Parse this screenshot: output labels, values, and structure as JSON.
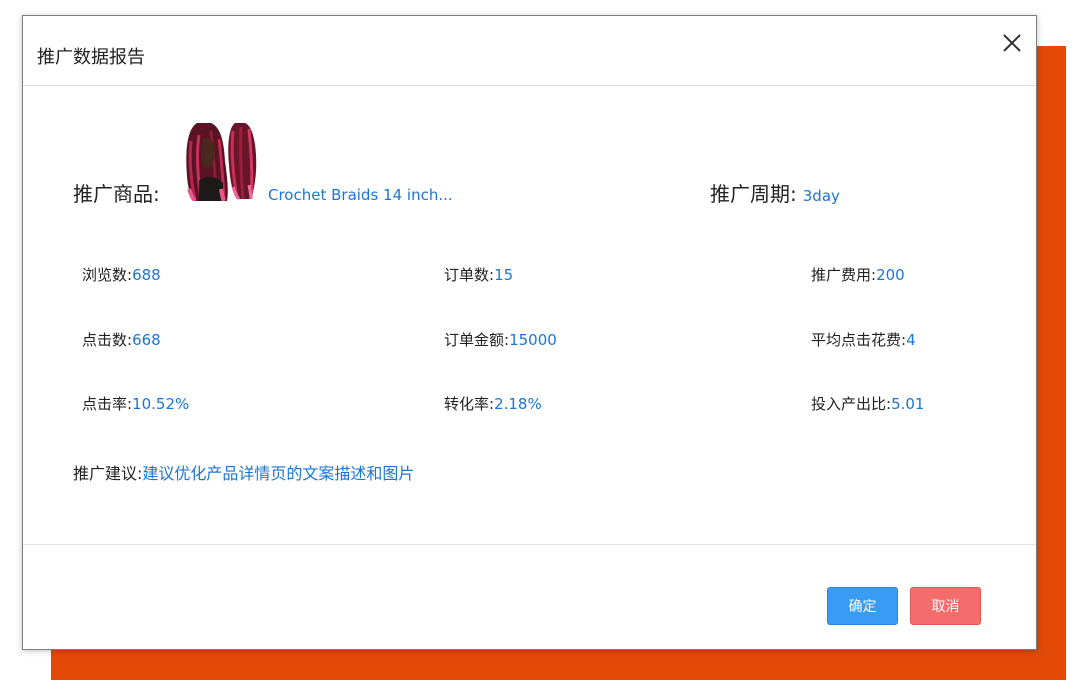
{
  "dialog": {
    "title": "推广数据报告",
    "close_icon": "close-icon"
  },
  "product": {
    "label": "推广商品:",
    "name": "Crochet Braids 14 inch...",
    "image_icon": "product-thumbnail"
  },
  "period": {
    "label": "推广周期:",
    "value": "3day"
  },
  "stats": {
    "views": {
      "label": "浏览数:",
      "value": "688"
    },
    "orders": {
      "label": "订单数:",
      "value": "15"
    },
    "promo_cost": {
      "label": "推广费用:",
      "value": "200"
    },
    "clicks": {
      "label": "点击数:",
      "value": "668"
    },
    "order_amount": {
      "label": "订单金额:",
      "value": "15000"
    },
    "avg_click_cost": {
      "label": "平均点击花费:",
      "value": "4"
    },
    "click_rate": {
      "label": "点击率:",
      "value": "10.52%"
    },
    "conversion_rate": {
      "label": "转化率:",
      "value": "2.18%"
    },
    "roi": {
      "label": "投入产出比:",
      "value": "5.01"
    }
  },
  "suggestion": {
    "label": "推广建议:",
    "value": "建议优化产品详情页的文案描述和图片"
  },
  "buttons": {
    "ok_label": "确定",
    "cancel_label": "取消"
  },
  "colors": {
    "accent_blue": "#1b76d2",
    "ok_button": "#3a9bf5",
    "cancel_button": "#f56c6c",
    "backdrop_orange": "#e24a06"
  }
}
